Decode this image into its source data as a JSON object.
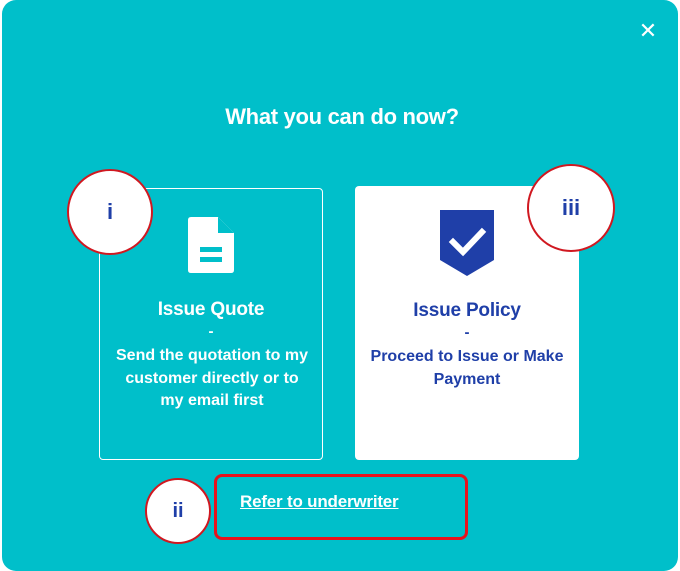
{
  "dialog": {
    "title": "What you can do now?",
    "close_glyph": "✕"
  },
  "options": {
    "quote": {
      "heading": "Issue Quote",
      "dash": "-",
      "description": "Send the quotation to my customer directly or to my email first",
      "icon": "document-icon"
    },
    "policy": {
      "heading": "Issue Policy",
      "dash": "-",
      "description": "Proceed to Issue or Make Payment",
      "icon": "shield-check-icon"
    }
  },
  "refer_link": "Refer to underwriter",
  "annotations": {
    "marker_i": "i",
    "marker_ii": "ii",
    "marker_iii": "iii"
  },
  "colors": {
    "background": "#00bfca",
    "accent_blue": "#1f3fa8",
    "highlight_red": "#e8121c"
  }
}
